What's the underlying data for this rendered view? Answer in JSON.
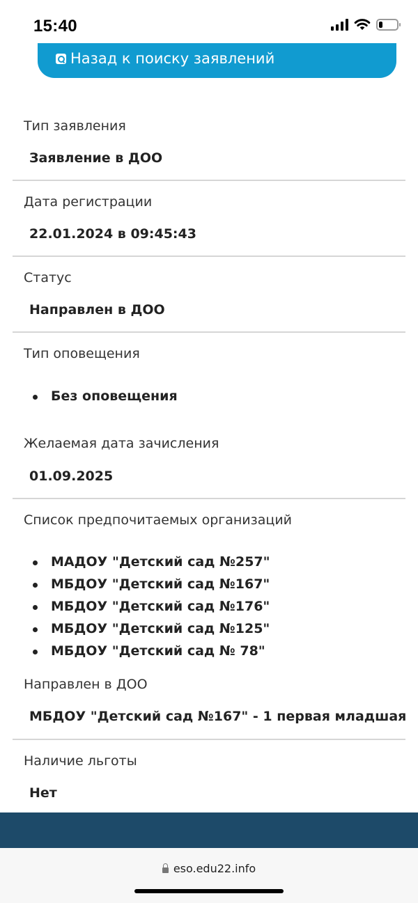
{
  "status_bar": {
    "time": "15:40",
    "battery_level": 0.2,
    "icons": [
      "cellular-signal-icon",
      "wifi-icon",
      "battery-icon"
    ]
  },
  "back_button": {
    "icon": "search-document-icon",
    "label": "Назад к поиску заявлений",
    "color": "#119bd0"
  },
  "fields": {
    "application_type": {
      "label": "Тип заявления",
      "value": "Заявление в ДОО"
    },
    "registration_date": {
      "label": "Дата регистрации",
      "value": "22.01.2024 в 09:45:43"
    },
    "status": {
      "label": "Статус",
      "value": "Направлен в ДОО"
    },
    "notification_type": {
      "label": "Тип оповещения",
      "items": [
        "Без оповещения"
      ]
    },
    "desired_enrollment_date": {
      "label": "Желаемая дата зачисления",
      "value": "01.09.2025"
    },
    "preferred_organizations": {
      "label": "Список предпочитаемых организаций",
      "items": [
        "МАДОУ \"Детский сад №257\"",
        "МБДОУ \"Детский сад №167\"",
        "МБДОУ \"Детский сад №176\"",
        "МБДОУ \"Детский сад №125\"",
        "МБДОУ \"Детский сад № 78\""
      ]
    },
    "assigned_to": {
      "label": "Направлен в ДОО",
      "value": "МБДОУ \"Детский сад №167\" - 1 первая младшая"
    },
    "benefit": {
      "label": "Наличие льготы",
      "value": "Нет"
    }
  },
  "footer": {
    "color": "#1d4a69"
  },
  "browser": {
    "url": "eso.edu22.info",
    "lock_icon": "lock-icon"
  }
}
